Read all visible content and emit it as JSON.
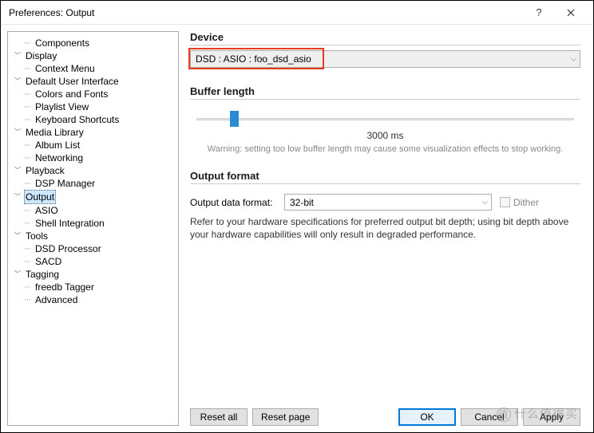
{
  "window": {
    "title": "Preferences: Output"
  },
  "tree": {
    "components": "Components",
    "display": "Display",
    "context_menu": "Context Menu",
    "default_ui": "Default User Interface",
    "colors_fonts": "Colors and Fonts",
    "playlist_view": "Playlist View",
    "keyboard_shortcuts": "Keyboard Shortcuts",
    "media_library": "Media Library",
    "album_list": "Album List",
    "networking": "Networking",
    "playback": "Playback",
    "dsp_manager": "DSP Manager",
    "output": "Output",
    "asio": "ASIO",
    "shell_integration": "Shell Integration",
    "tools": "Tools",
    "dsd_processor": "DSD Processor",
    "sacd": "SACD",
    "tagging": "Tagging",
    "freedb_tagger": "freedb Tagger",
    "advanced": "Advanced"
  },
  "device": {
    "heading": "Device",
    "selected": "DSD : ASIO : foo_dsd_asio"
  },
  "buffer": {
    "heading": "Buffer length",
    "value": "3000 ms",
    "warning": "Warning: setting too low buffer length may cause some visualization effects to stop working."
  },
  "output_format": {
    "heading": "Output format",
    "label": "Output data format:",
    "selected": "32-bit",
    "dither": "Dither",
    "help": "Refer to your hardware specifications for preferred output bit depth; using bit depth above your hardware capabilities will only result in degraded performance."
  },
  "buttons": {
    "reset_all": "Reset all",
    "reset_page": "Reset page",
    "ok": "OK",
    "cancel": "Cancel",
    "apply": "Apply"
  },
  "watermark": "什么值得买"
}
